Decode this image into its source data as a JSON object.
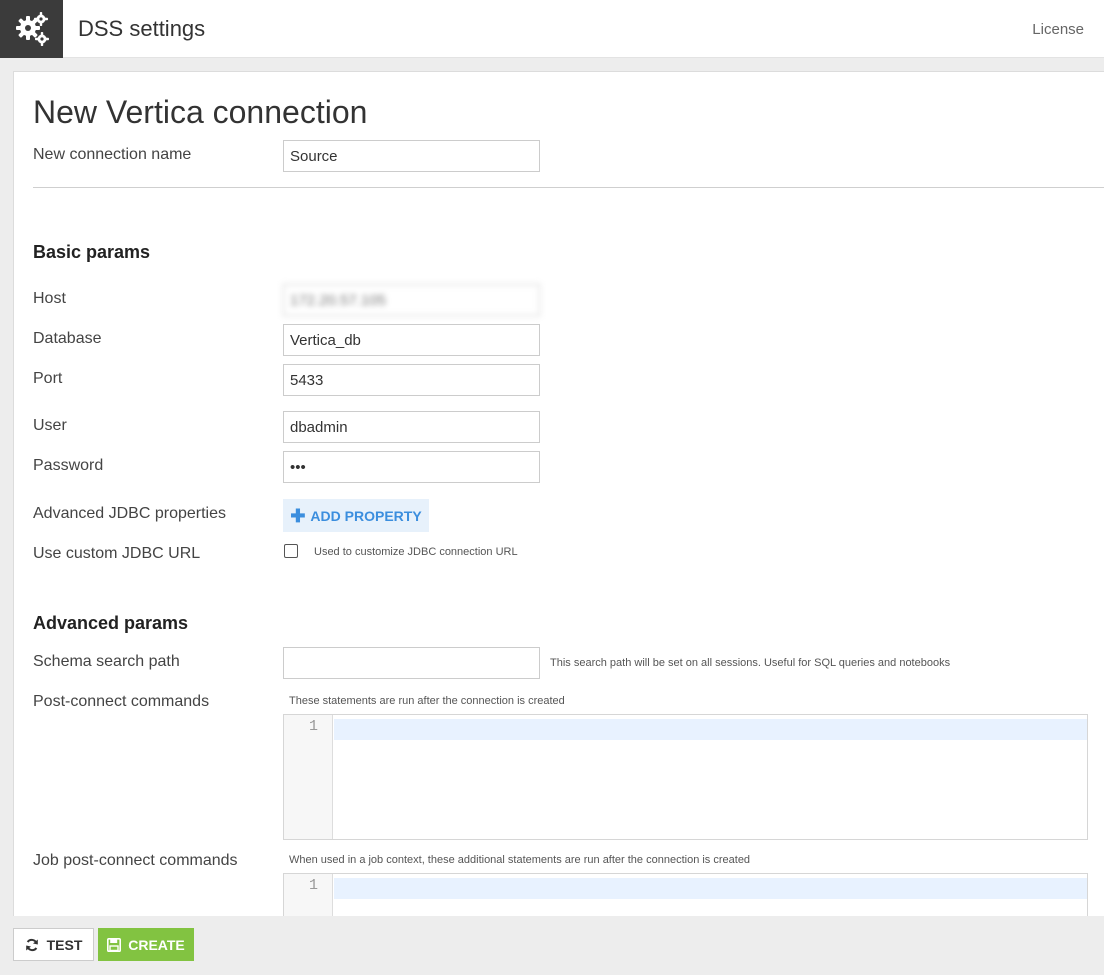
{
  "header": {
    "app_title": "DSS settings",
    "license_label": "License",
    "logo_icon": "gears-icon"
  },
  "form": {
    "page_title": "New Vertica connection",
    "name_label": "New connection name",
    "name_value": "Source",
    "basic": {
      "title": "Basic params",
      "host_label": "Host",
      "host_value": "172.20.57.105",
      "database_label": "Database",
      "database_value": "Vertica_db",
      "port_label": "Port",
      "port_value": "5433",
      "user_label": "User",
      "user_value": "dbadmin",
      "password_label": "Password",
      "password_value": "•••",
      "jdbc_props_label": "Advanced JDBC properties",
      "add_property_label": "ADD PROPERTY",
      "custom_url_label": "Use custom JDBC URL",
      "custom_url_help": "Used to customize JDBC connection URL",
      "custom_url_checked": false
    },
    "advanced": {
      "title": "Advanced params",
      "schema_label": "Schema search path",
      "schema_value": "",
      "schema_help": "This search path will be set on all sessions. Useful for SQL queries and notebooks",
      "post_connect_label": "Post-connect commands",
      "post_connect_help": "These statements are run after the connection is created",
      "post_connect_line": "1",
      "job_post_connect_label": "Job post-connect commands",
      "job_post_connect_help": "When used in a job context, these additional statements are run after the connection is created",
      "job_post_connect_line": "1"
    }
  },
  "footer": {
    "test_label": "TEST",
    "create_label": "CREATE"
  },
  "colors": {
    "create_button": "#82c341",
    "add_property_text": "#3b8ede",
    "add_property_bg": "#e7f1fb",
    "logo_bg": "#3b3b3b"
  }
}
